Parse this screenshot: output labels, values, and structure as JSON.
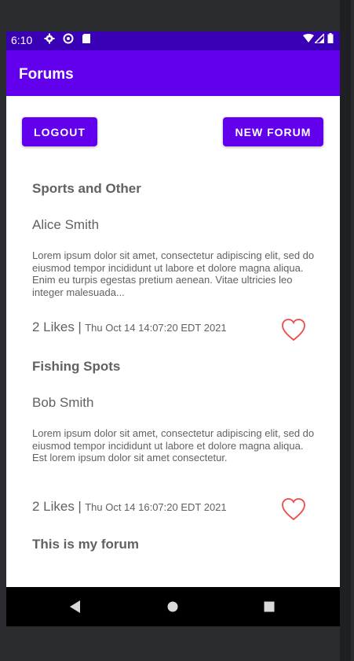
{
  "status_bar": {
    "time": "6:10",
    "icons": [
      "gear-icon",
      "target-icon",
      "sd-card-icon",
      "wifi-icon",
      "signal-icon",
      "battery-icon"
    ]
  },
  "app_bar": {
    "title": "Forums"
  },
  "buttons": {
    "logout": "LOGOUT",
    "new_forum": "NEW FORUM"
  },
  "posts": [
    {
      "title": "Sports and Other",
      "author": "Alice Smith",
      "body": "Lorem ipsum dolor sit amet, consectetur adipiscing elit, sed do eiusmod tempor incididunt ut labore et dolore magna aliqua. Enim eu turpis egestas pretium aenean. Vitae ultricies leo integer malesuada...",
      "likes": "2 Likes",
      "separator": "|",
      "date": "Thu Oct 14 14:07:20 EDT 2021"
    },
    {
      "title": "Fishing Spots",
      "author": "Bob Smith",
      "body": "Lorem ipsum dolor sit amet, consectetur adipiscing elit, sed do eiusmod tempor incididunt ut labore et dolore magna aliqua. Est lorem ipsum dolor sit amet consectetur.",
      "likes": "2 Likes",
      "separator": "|",
      "date": "Thu Oct 14 16:07:20 EDT 2021"
    },
    {
      "title": "This is my forum"
    }
  ],
  "colors": {
    "primary": "#6200ee",
    "status_bar": "#3a00b6",
    "heart": "#f04848",
    "text": "#616161"
  }
}
